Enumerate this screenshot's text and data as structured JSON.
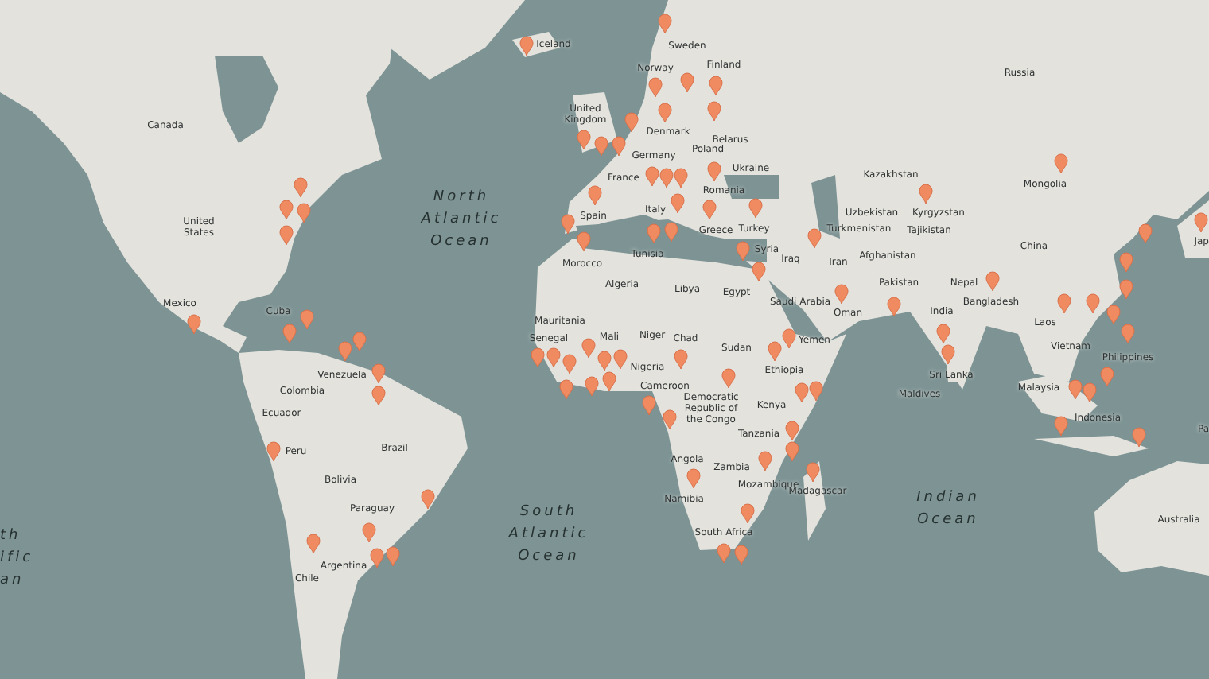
{
  "map": {
    "labels": [
      {
        "kind": "ocean",
        "lines": [
          "North",
          "Atlantic",
          "Ocean"
        ]
      },
      {
        "kind": "ocean",
        "lines": [
          "South",
          "Atlantic",
          "Ocean"
        ]
      },
      {
        "kind": "ocean",
        "lines": [
          "Indian",
          "Ocean"
        ]
      },
      {
        "kind": "ocean",
        "lines": [
          "th",
          "ific",
          "an"
        ]
      },
      {
        "kind": "country",
        "lines": [
          "Canada"
        ]
      },
      {
        "kind": "country",
        "lines": [
          "United",
          "States"
        ]
      },
      {
        "kind": "country",
        "lines": [
          "Mexico"
        ]
      },
      {
        "kind": "country",
        "lines": [
          "Cuba"
        ]
      },
      {
        "kind": "country",
        "lines": [
          "Venezuela"
        ]
      },
      {
        "kind": "country",
        "lines": [
          "Colombia"
        ]
      },
      {
        "kind": "country",
        "lines": [
          "Ecuador"
        ]
      },
      {
        "kind": "country",
        "lines": [
          "Peru"
        ]
      },
      {
        "kind": "country",
        "lines": [
          "Brazil"
        ]
      },
      {
        "kind": "country",
        "lines": [
          "Bolivia"
        ]
      },
      {
        "kind": "country",
        "lines": [
          "Paraguay"
        ]
      },
      {
        "kind": "country",
        "lines": [
          "Argentina"
        ]
      },
      {
        "kind": "country",
        "lines": [
          "Chile"
        ]
      },
      {
        "kind": "country",
        "lines": [
          "Iceland"
        ]
      },
      {
        "kind": "country",
        "lines": [
          "Sweden"
        ]
      },
      {
        "kind": "country",
        "lines": [
          "Finland"
        ]
      },
      {
        "kind": "country",
        "lines": [
          "Norway"
        ]
      },
      {
        "kind": "country",
        "lines": [
          "United",
          "Kingdom"
        ]
      },
      {
        "kind": "country",
        "lines": [
          "Denmark"
        ]
      },
      {
        "kind": "country",
        "lines": [
          "Belarus"
        ]
      },
      {
        "kind": "country",
        "lines": [
          "Poland"
        ]
      },
      {
        "kind": "country",
        "lines": [
          "Germany"
        ]
      },
      {
        "kind": "country",
        "lines": [
          "Ukraine"
        ]
      },
      {
        "kind": "country",
        "lines": [
          "France"
        ]
      },
      {
        "kind": "country",
        "lines": [
          "Romania"
        ]
      },
      {
        "kind": "country",
        "lines": [
          "Italy"
        ]
      },
      {
        "kind": "country",
        "lines": [
          "Spain"
        ]
      },
      {
        "kind": "country",
        "lines": [
          "Greece"
        ]
      },
      {
        "kind": "country",
        "lines": [
          "Turkey"
        ]
      },
      {
        "kind": "country",
        "lines": [
          "Syria"
        ]
      },
      {
        "kind": "country",
        "lines": [
          "Iraq"
        ]
      },
      {
        "kind": "country",
        "lines": [
          "Morocco"
        ]
      },
      {
        "kind": "country",
        "lines": [
          "Tunisia"
        ]
      },
      {
        "kind": "country",
        "lines": [
          "Algeria"
        ]
      },
      {
        "kind": "country",
        "lines": [
          "Libya"
        ]
      },
      {
        "kind": "country",
        "lines": [
          "Egypt"
        ]
      },
      {
        "kind": "country",
        "lines": [
          "Saudi Arabia"
        ]
      },
      {
        "kind": "country",
        "lines": [
          "Mauritania"
        ]
      },
      {
        "kind": "country",
        "lines": [
          "Senegal"
        ]
      },
      {
        "kind": "country",
        "lines": [
          "Mali"
        ]
      },
      {
        "kind": "country",
        "lines": [
          "Niger"
        ]
      },
      {
        "kind": "country",
        "lines": [
          "Chad"
        ]
      },
      {
        "kind": "country",
        "lines": [
          "Sudan"
        ]
      },
      {
        "kind": "country",
        "lines": [
          "Nigeria"
        ]
      },
      {
        "kind": "country",
        "lines": [
          "Ethiopia"
        ]
      },
      {
        "kind": "country",
        "lines": [
          "Yemen"
        ]
      },
      {
        "kind": "country",
        "lines": [
          "Cameroon"
        ]
      },
      {
        "kind": "country",
        "lines": [
          "Democratic",
          "Republic of",
          "the Congo"
        ]
      },
      {
        "kind": "country",
        "lines": [
          "Kenya"
        ]
      },
      {
        "kind": "country",
        "lines": [
          "Tanzania"
        ]
      },
      {
        "kind": "country",
        "lines": [
          "Angola"
        ]
      },
      {
        "kind": "country",
        "lines": [
          "Zambia"
        ]
      },
      {
        "kind": "country",
        "lines": [
          "Mozambique"
        ]
      },
      {
        "kind": "country",
        "lines": [
          "Madagascar"
        ]
      },
      {
        "kind": "country",
        "lines": [
          "Namibia"
        ]
      },
      {
        "kind": "country",
        "lines": [
          "South Africa"
        ]
      },
      {
        "kind": "country",
        "lines": [
          "Russia"
        ]
      },
      {
        "kind": "country",
        "lines": [
          "Kazakhstan"
        ]
      },
      {
        "kind": "country",
        "lines": [
          "Mongolia"
        ]
      },
      {
        "kind": "country",
        "lines": [
          "Uzbekistan"
        ]
      },
      {
        "kind": "country",
        "lines": [
          "Kyrgyzstan"
        ]
      },
      {
        "kind": "country",
        "lines": [
          "Turkmenistan"
        ]
      },
      {
        "kind": "country",
        "lines": [
          "Tajikistan"
        ]
      },
      {
        "kind": "country",
        "lines": [
          "Iran"
        ]
      },
      {
        "kind": "country",
        "lines": [
          "Afghanistan"
        ]
      },
      {
        "kind": "country",
        "lines": [
          "China"
        ]
      },
      {
        "kind": "country",
        "lines": [
          "Pakistan"
        ]
      },
      {
        "kind": "country",
        "lines": [
          "Nepal"
        ]
      },
      {
        "kind": "country",
        "lines": [
          "India"
        ]
      },
      {
        "kind": "country",
        "lines": [
          "Bangladesh"
        ]
      },
      {
        "kind": "country",
        "lines": [
          "Oman"
        ]
      },
      {
        "kind": "country",
        "lines": [
          "Laos"
        ]
      },
      {
        "kind": "country",
        "lines": [
          "Vietnam"
        ]
      },
      {
        "kind": "country",
        "lines": [
          "Philippines"
        ]
      },
      {
        "kind": "country",
        "lines": [
          "Sri Lanka"
        ]
      },
      {
        "kind": "country",
        "lines": [
          "Malaysia"
        ]
      },
      {
        "kind": "country",
        "lines": [
          "Maldives"
        ]
      },
      {
        "kind": "country",
        "lines": [
          "Indonesia"
        ]
      },
      {
        "kind": "country",
        "lines": [
          "Australia"
        ]
      },
      {
        "kind": "country",
        "lines": [
          "Jap"
        ]
      },
      {
        "kind": "country",
        "lines": [
          "Pa"
        ]
      }
    ]
  }
}
